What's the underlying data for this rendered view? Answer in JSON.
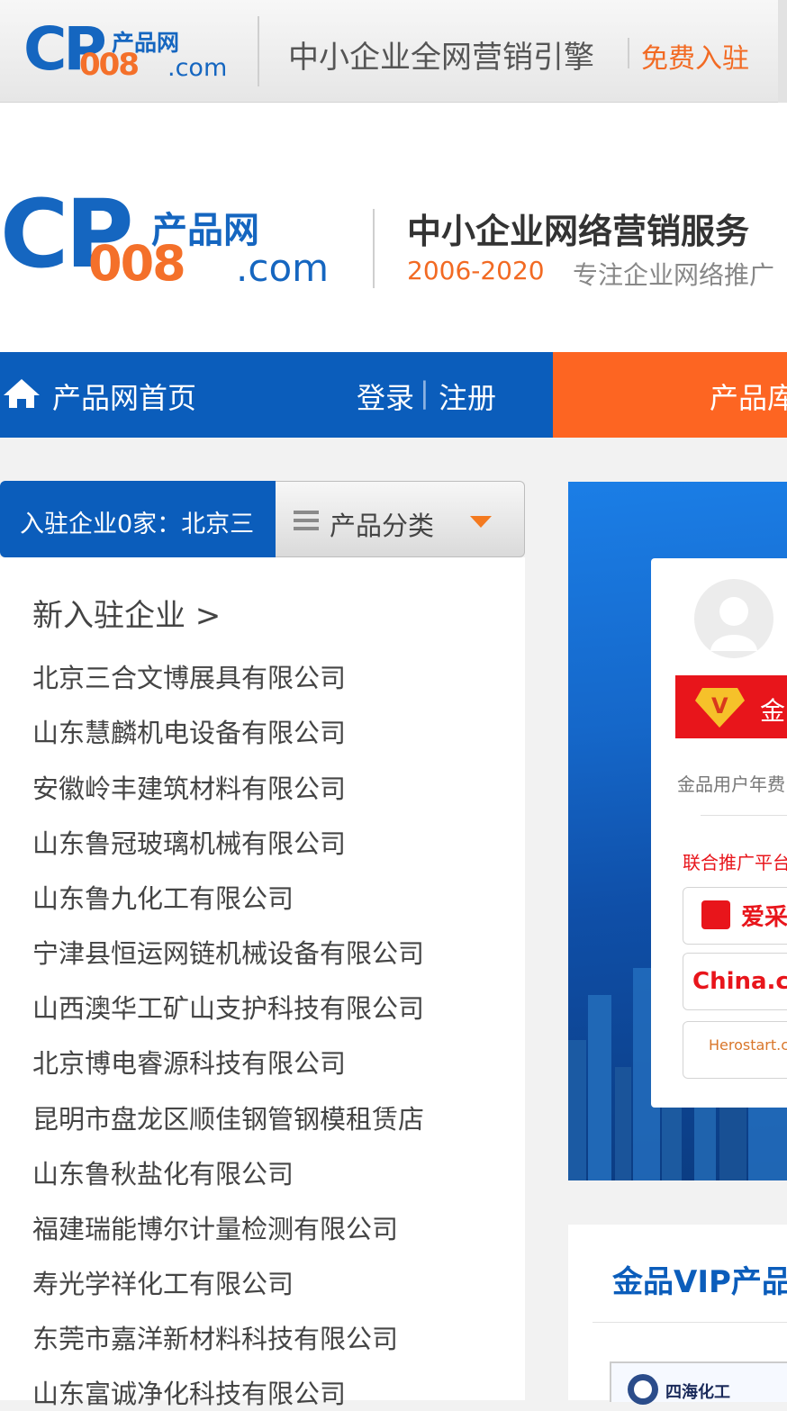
{
  "topbar": {
    "logo_cp": "CP",
    "logo_cn": "产品网",
    "logo_num": "008",
    "logo_com": ".com",
    "slogan": "中小企业全网营销引擎",
    "free_join": "免费入驻"
  },
  "header": {
    "logo_cp": "CP",
    "logo_cn": "产品网",
    "logo_num": "008",
    "logo_com": ".com",
    "slogan": "中小企业网络营销服务",
    "years": "2006-2020",
    "focus": "专注企业网络推广"
  },
  "nav": {
    "home": "产品网首页",
    "login": "登录",
    "sep": "|",
    "register": "注册",
    "library": "产品库"
  },
  "tabs": {
    "enterprise_ticker": "入驻企业0家：北京三",
    "category": "产品分类"
  },
  "left": {
    "new_enterprises": "新入驻企业 >",
    "companies": [
      "北京三合文博展具有限公司",
      "山东慧麟机电设备有限公司",
      "安徽岭丰建筑材料有限公司",
      "山东鲁冠玻璃机械有限公司",
      "山东鲁九化工有限公司",
      "宁津县恒运网链机械设备有限公司",
      "山西澳华工矿山支护科技有限公司",
      "北京博电睿源科技有限公司",
      "昆明市盘龙区顺佳钢管钢模租赁店",
      "山东鲁秋盐化有限公司",
      "福建瑞能博尔计量检测有限公司",
      "寿光学祥化工有限公司",
      "东莞市嘉洋新材料科技有限公司",
      "山东富诚净化科技有限公司"
    ]
  },
  "banner": {
    "gold_label": "金",
    "gold_user_fee": "金品用户年费",
    "partner_title": "联合推广平台",
    "partners": [
      "爱采",
      "China.c",
      "Herostart.c"
    ]
  },
  "vip": {
    "title": "金品VIP产品",
    "thumb_text": "四海化工"
  },
  "colors": {
    "brand_blue": "#0b5dbb",
    "brand_orange": "#fd6522",
    "gold_red": "#e8151b"
  }
}
